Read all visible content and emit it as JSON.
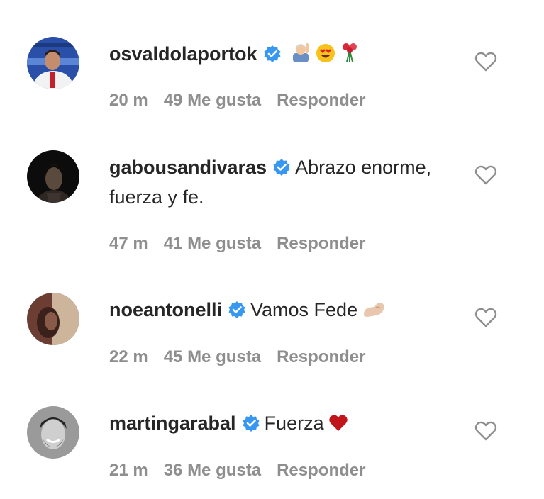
{
  "comments": [
    {
      "username": "osvaldolaportok",
      "text": "",
      "emoji_icons": [
        "person-raising-hand-emoji-icon",
        "heart-eyes-emoji-icon",
        "roses-emoji-icon"
      ],
      "time": "20 m",
      "likes": "49 Me gusta",
      "reply": "Responder",
      "avatar": "tv-host-avatar"
    },
    {
      "username": "gabousandivaras",
      "text": "Abrazo enorme, fuerza y fe.",
      "emoji_icons": [],
      "time": "47 m",
      "likes": "41 Me gusta",
      "reply": "Responder",
      "avatar": "dark-portrait-avatar"
    },
    {
      "username": "noeantonelli",
      "text": "Vamos Fede",
      "emoji_icons": [
        "flexed-biceps-emoji-icon"
      ],
      "time": "22 m",
      "likes": "45 Me gusta",
      "reply": "Responder",
      "avatar": "woman-portrait-avatar"
    },
    {
      "username": "martingarabal",
      "text": "Fuerza",
      "emoji_icons": [
        "red-heart-emoji-icon"
      ],
      "time": "21 m",
      "likes": "36 Me gusta",
      "reply": "Responder",
      "avatar": "smiling-man-avatar"
    }
  ],
  "colors": {
    "username": "#262626",
    "meta": "#8e8e8e",
    "verified": "#3897f0",
    "heart_outline": "#8e8e8e",
    "red_heart": "#c0151b"
  }
}
